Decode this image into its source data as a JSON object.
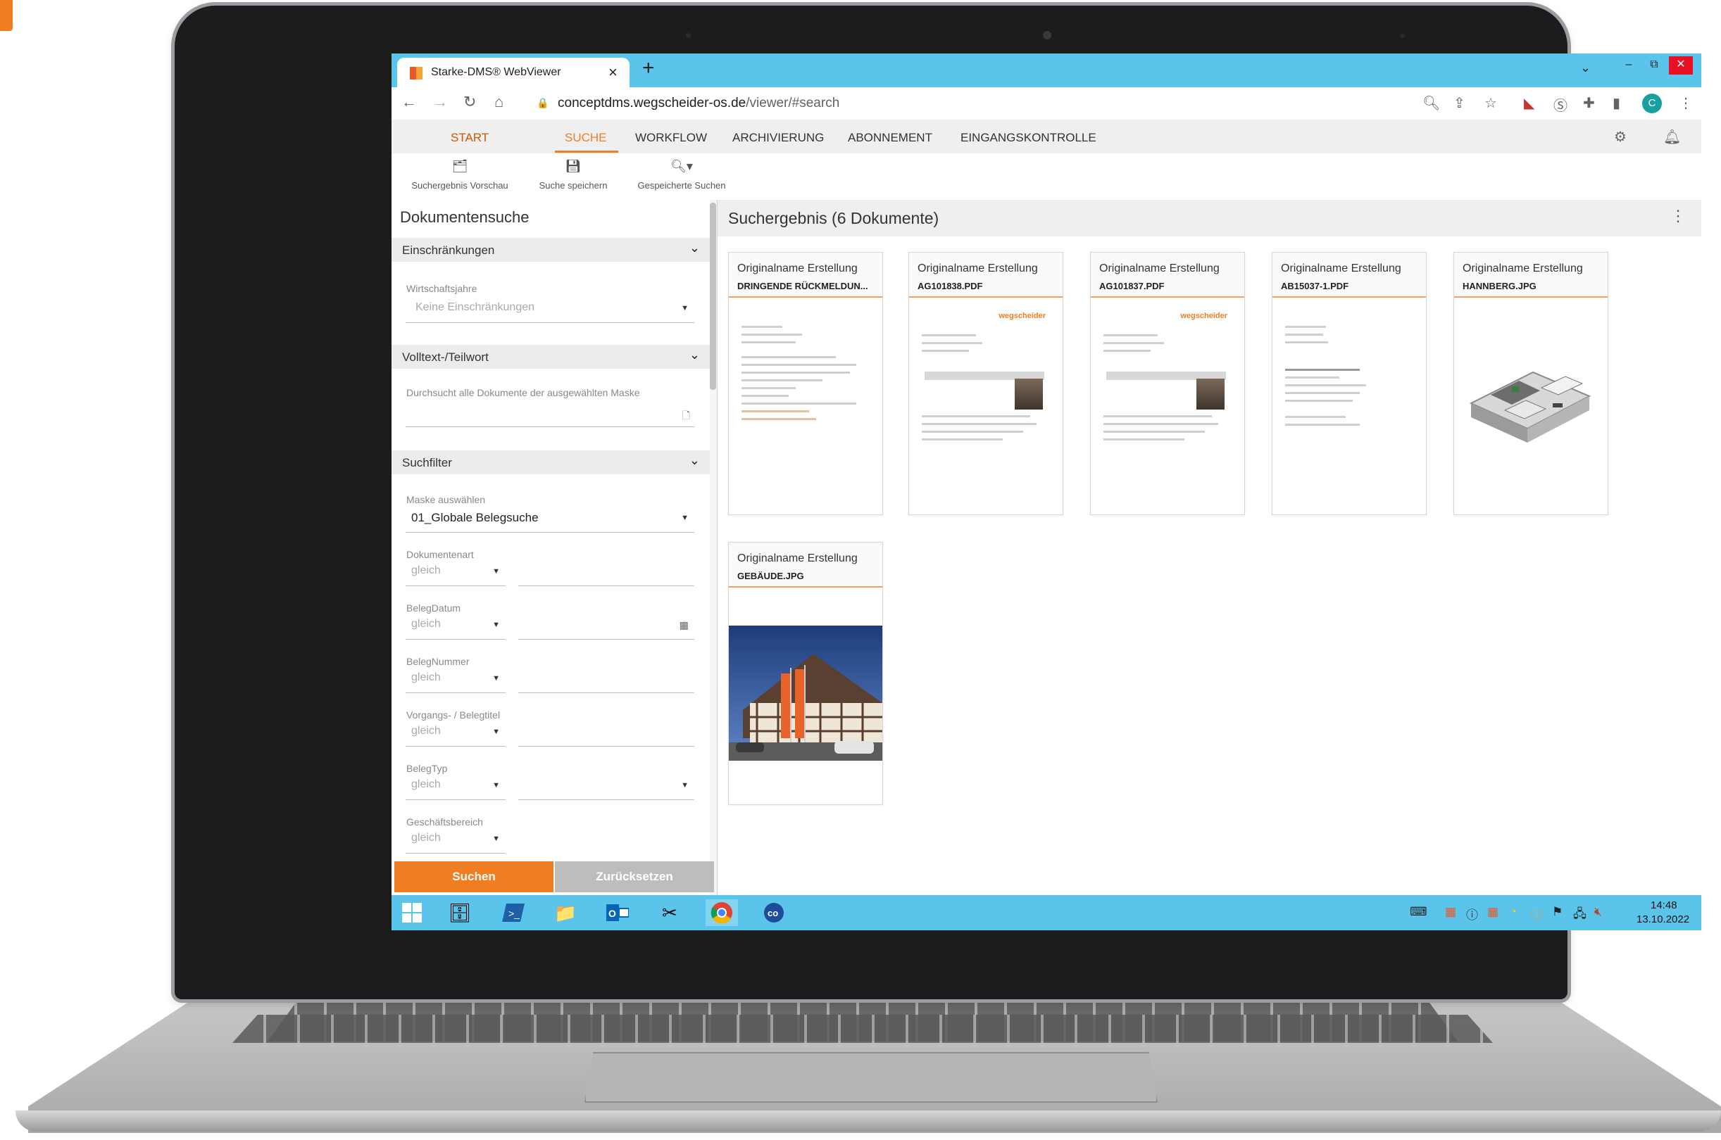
{
  "browser": {
    "tab_title": "Starke-DMS® WebViewer",
    "url_host": "conceptdms.wegscheider-os.de",
    "url_path": "/viewer/#search",
    "profile_initial": "C"
  },
  "nav": {
    "start": "START",
    "suche": "SUCHE",
    "workflow": "WORKFLOW",
    "archivierung": "ARCHIVIERUNG",
    "abonnement": "ABONNEMENT",
    "eingangskontrolle": "EINGANGSKONTROLLE"
  },
  "toolbar": {
    "preview": "Suchergebnis Vorschau",
    "save": "Suche speichern",
    "saved": "Gespeicherte Suchen"
  },
  "search_panel": {
    "title": "Dokumentensuche",
    "restrictions": {
      "header": "Einschränkungen",
      "label": "Wirtschaftsjahre",
      "value": "Keine Einschränkungen"
    },
    "fulltext": {
      "header": "Volltext-/Teilwort",
      "placeholder": "Durchsucht alle Dokumente der ausgewählten Maske"
    },
    "filter": {
      "header": "Suchfilter",
      "mask_label": "Maske auswählen",
      "mask_value": "01_Globale Belegsuche",
      "fields": [
        {
          "label": "Dokumentenart",
          "operator": "gleich"
        },
        {
          "label": "BelegDatum",
          "operator": "gleich"
        },
        {
          "label": "BelegNummer",
          "operator": "gleich"
        },
        {
          "label": "Vorgangs- / Belegtitel",
          "operator": "gleich"
        },
        {
          "label": "BelegTyp",
          "operator": "gleich"
        },
        {
          "label": "Geschäftsbereich",
          "operator": "gleich"
        }
      ]
    },
    "search_button": "Suchen",
    "reset_button": "Zurücksetzen"
  },
  "results": {
    "title": "Suchergebnis (6 Dokumente)",
    "cards": [
      {
        "label": "Originalname Erstellung",
        "name": "DRINGENDE RÜCKMELDUN...",
        "type": "letter"
      },
      {
        "label": "Originalname Erstellung",
        "name": "AG101838.PDF",
        "type": "offer",
        "logo": "wegscheider"
      },
      {
        "label": "Originalname Erstellung",
        "name": "AG101837.PDF",
        "type": "offer",
        "logo": "wegscheider"
      },
      {
        "label": "Originalname Erstellung",
        "name": "AB15037-1.PDF",
        "type": "letter"
      },
      {
        "label": "Originalname Erstellung",
        "name": "HANNBERG.JPG",
        "type": "floorplan"
      },
      {
        "label": "Originalname Erstellung",
        "name": "GEBÄUDE.JPG",
        "type": "photo"
      }
    ]
  },
  "taskbar": {
    "time": "14:48",
    "date": "13.10.2022"
  },
  "colors": {
    "accent": "#f07d22",
    "browser_bar": "#5bc4ea"
  }
}
